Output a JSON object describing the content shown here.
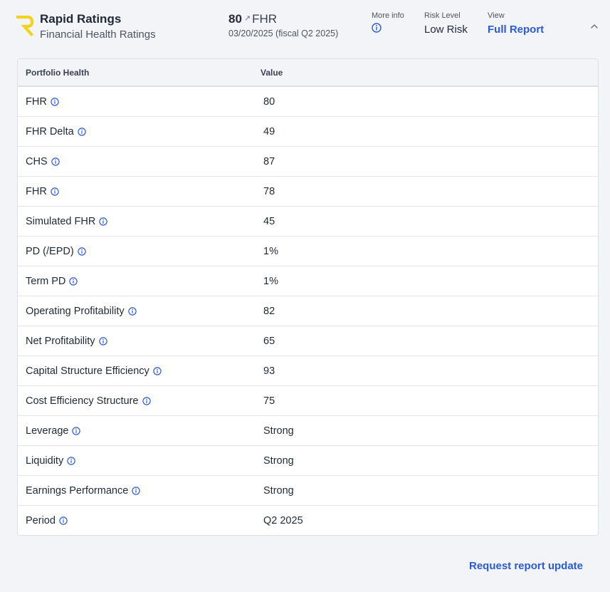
{
  "header": {
    "brand_title": "Rapid Ratings",
    "brand_subtitle": "Financial Health Ratings",
    "score_value": "80",
    "score_trend_glyph": "↗",
    "score_unit": "FHR",
    "score_date": "03/20/2025 (fiscal Q2 2025)",
    "more_info_label": "More info",
    "risk_level_label": "Risk Level",
    "risk_level_value": "Low Risk",
    "view_label": "View",
    "full_report_link": "Full Report",
    "logo_color": "#f2d21b",
    "link_color": "#2a5bd7"
  },
  "table": {
    "headers": {
      "metric": "Portfolio Health",
      "value": "Value"
    },
    "rows": [
      {
        "label": "FHR",
        "value": "80"
      },
      {
        "label": "FHR Delta",
        "value": "49"
      },
      {
        "label": "CHS",
        "value": "87"
      },
      {
        "label": "FHR",
        "value": "78"
      },
      {
        "label": "Simulated FHR",
        "value": "45"
      },
      {
        "label": "PD (/EPD)",
        "value": "1%"
      },
      {
        "label": "Term PD",
        "value": "1%"
      },
      {
        "label": "Operating Profitability",
        "value": "82"
      },
      {
        "label": "Net Profitability",
        "value": "65"
      },
      {
        "label": "Capital Structure Efficiency",
        "value": "93"
      },
      {
        "label": "Cost Efficiency Structure",
        "value": "75"
      },
      {
        "label": "Leverage",
        "value": "Strong"
      },
      {
        "label": "Liquidity",
        "value": "Strong"
      },
      {
        "label": "Earnings Performance",
        "value": "Strong"
      },
      {
        "label": "Period",
        "value": "Q2 2025"
      }
    ]
  },
  "footer": {
    "request_update_link": "Request report update"
  }
}
